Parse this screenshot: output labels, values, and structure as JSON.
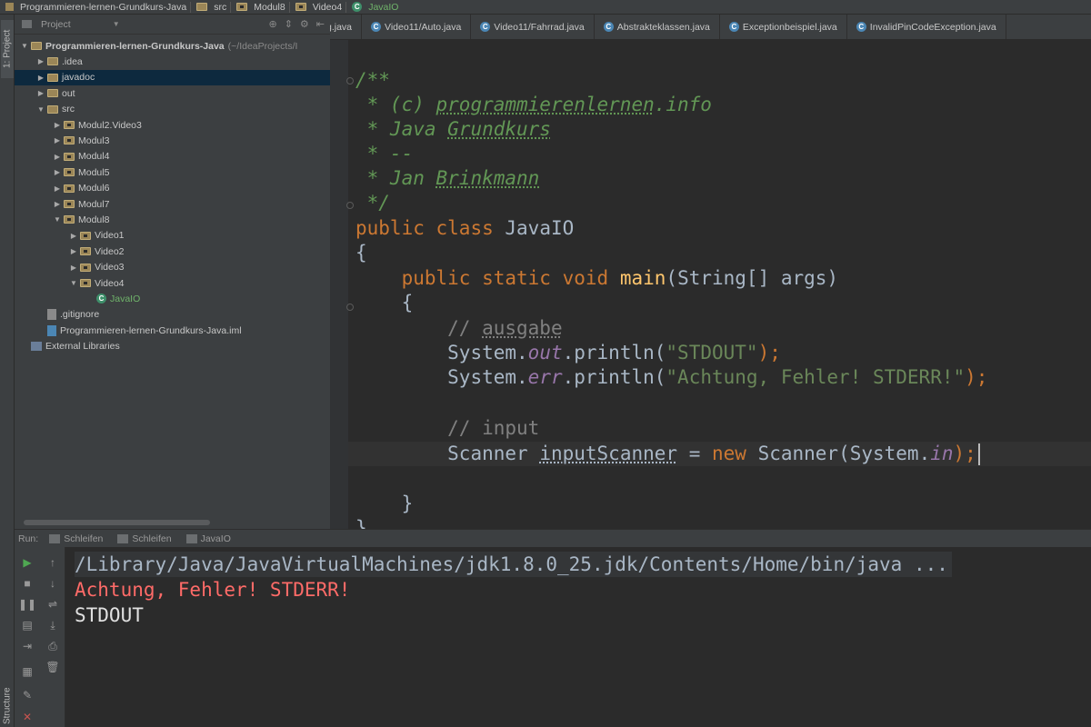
{
  "breadcrumb": [
    {
      "label": "Programmieren-lernen-Grundkurs-Java",
      "icon": "project-icon"
    },
    {
      "label": "src",
      "icon": "folder-icon"
    },
    {
      "label": "Modul8",
      "icon": "folder-icon"
    },
    {
      "label": "Video4",
      "icon": "folder-icon"
    },
    {
      "label": "JavaIO",
      "icon": "class-icon"
    }
  ],
  "left_strip": {
    "project_tab": "1: Project",
    "structure_tab": "Structure"
  },
  "project_panel": {
    "title": "Project",
    "tree": [
      {
        "label": "Programmieren-lernen-Grundkurs-Java",
        "suffix": "(~/IdeaProjects/I",
        "indent": 0,
        "arrow": "▼",
        "icon": "folder"
      },
      {
        "label": ".idea",
        "indent": 1,
        "arrow": "▶",
        "icon": "folder"
      },
      {
        "label": "javadoc",
        "indent": 1,
        "arrow": "▶",
        "icon": "folder",
        "selected": true
      },
      {
        "label": "out",
        "indent": 1,
        "arrow": "▶",
        "icon": "folder"
      },
      {
        "label": "src",
        "indent": 1,
        "arrow": "▼",
        "icon": "folder"
      },
      {
        "label": "Modul2.Video3",
        "indent": 2,
        "arrow": "▶",
        "icon": "package"
      },
      {
        "label": "Modul3",
        "indent": 2,
        "arrow": "▶",
        "icon": "package"
      },
      {
        "label": "Modul4",
        "indent": 2,
        "arrow": "▶",
        "icon": "package"
      },
      {
        "label": "Modul5",
        "indent": 2,
        "arrow": "▶",
        "icon": "package"
      },
      {
        "label": "Modul6",
        "indent": 2,
        "arrow": "▶",
        "icon": "package"
      },
      {
        "label": "Modul7",
        "indent": 2,
        "arrow": "▶",
        "icon": "package"
      },
      {
        "label": "Modul8",
        "indent": 2,
        "arrow": "▼",
        "icon": "package"
      },
      {
        "label": "Video1",
        "indent": 3,
        "arrow": "▶",
        "icon": "package"
      },
      {
        "label": "Video2",
        "indent": 3,
        "arrow": "▶",
        "icon": "package"
      },
      {
        "label": "Video3",
        "indent": 3,
        "arrow": "▶",
        "icon": "package"
      },
      {
        "label": "Video4",
        "indent": 3,
        "arrow": "▼",
        "icon": "package"
      },
      {
        "label": "JavaIO",
        "indent": 4,
        "arrow": "",
        "icon": "class",
        "java": true
      },
      {
        "label": ".gitignore",
        "indent": 1,
        "arrow": "",
        "icon": "file"
      },
      {
        "label": "Programmieren-lernen-Grundkurs-Java.iml",
        "indent": 1,
        "arrow": "",
        "icon": "iml"
      },
      {
        "label": "External Libraries",
        "indent": 0,
        "arrow": "",
        "icon": "library"
      }
    ]
  },
  "editor_tabs": [
    {
      "label": "g.java",
      "icon": ""
    },
    {
      "label": "Video11/Auto.java",
      "icon": "C"
    },
    {
      "label": "Video11/Fahrrad.java",
      "icon": "C"
    },
    {
      "label": "Abstrakteklassen.java",
      "icon": "C"
    },
    {
      "label": "Exceptionbeispiel.java",
      "icon": "C"
    },
    {
      "label": "InvalidPinCodeException.java",
      "icon": "C"
    }
  ],
  "code": {
    "doc_open": "/**",
    "doc_line1_prefix": " * (c) ",
    "doc_line1_link": "programmierenlernen",
    "doc_line1_suffix": ".info",
    "doc_line2_prefix": " * Java ",
    "doc_line2_word": "Grundkurs",
    "doc_line3": " * --",
    "doc_line4_prefix": " * Jan ",
    "doc_line4_word": "Brinkmann",
    "doc_close": " */",
    "kw_public": "public",
    "kw_class": "class",
    "class_name": "JavaIO",
    "brace_open": "{",
    "kw_static": "static",
    "kw_void": "void",
    "method_main": "main",
    "main_params": "(String[] args)",
    "comment_ausgabe_prefix": "// ",
    "comment_ausgabe_word": "ausgabe",
    "sysout_prefix": "System.",
    "field_out": "out",
    "println": ".println(",
    "str_stdout": "\"STDOUT\"",
    "stmt_end": ");",
    "field_err": "err",
    "str_stderr": "\"Achtung, Fehler! STDERR!\"",
    "comment_input": "// input",
    "scanner_type": "Scanner",
    "scanner_var": "inputScanner",
    "assign": " = ",
    "kw_new": "new",
    "scanner_ctor": " Scanner(System.",
    "field_in": "in",
    "ctor_end": ");",
    "brace_close": "}"
  },
  "run_panel": {
    "label": "Run:",
    "tabs": [
      "Schleifen",
      "Schleifen",
      "JavaIO"
    ],
    "console": {
      "command": "/Library/Java/JavaVirtualMachines/jdk1.8.0_25.jdk/Contents/Home/bin/java ...",
      "stderr": "Achtung, Fehler! STDERR!",
      "stdout": "STDOUT"
    }
  }
}
